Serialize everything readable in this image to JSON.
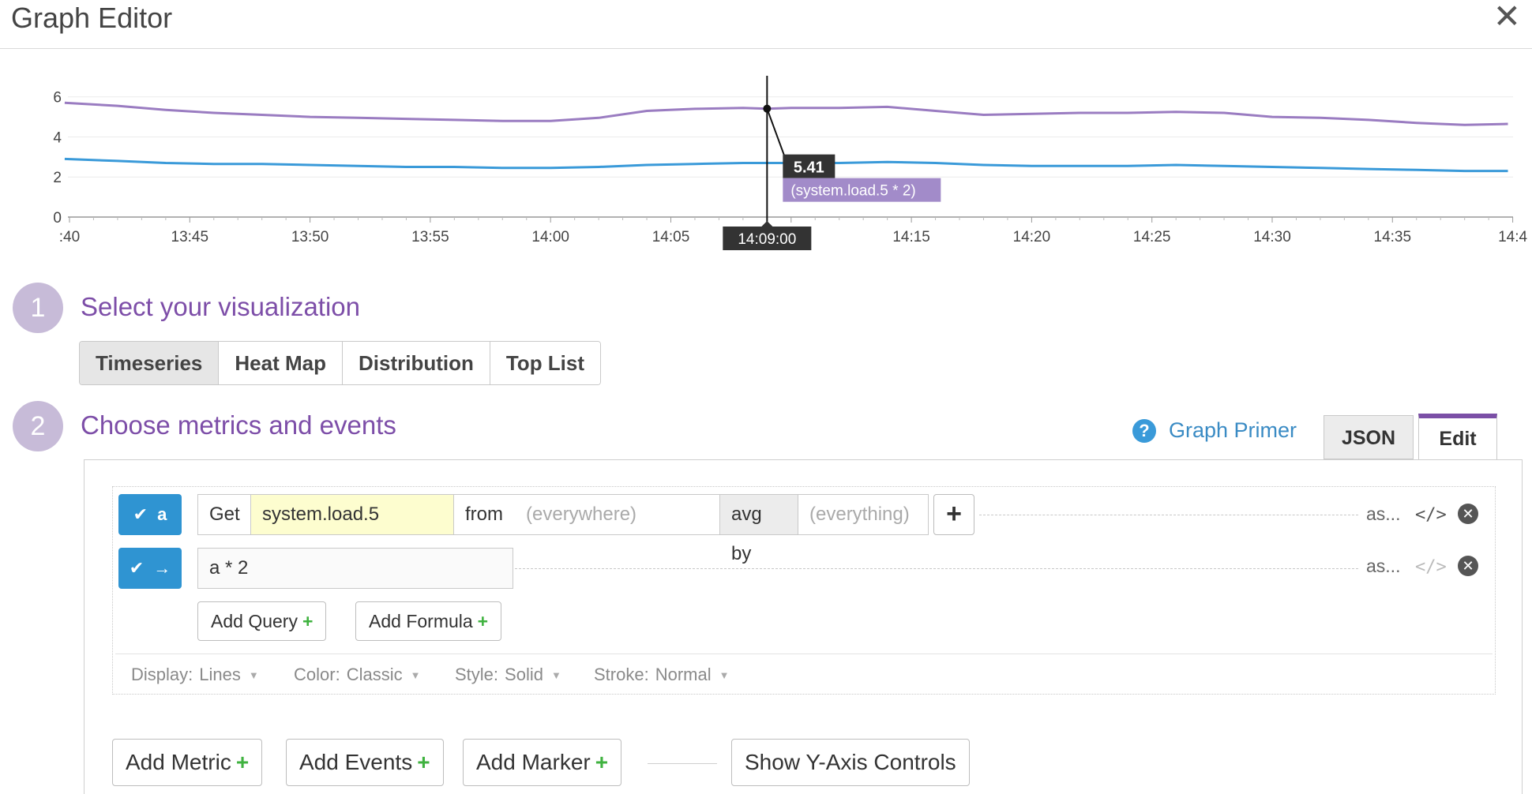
{
  "window": {
    "title": "Graph Editor",
    "close_glyph": "✕"
  },
  "chart_data": {
    "type": "line",
    "x_tick_labels": [
      ":40",
      "13:45",
      "13:50",
      "13:55",
      "14:00",
      "14:05",
      "14:10",
      "14:15",
      "14:20",
      "14:25",
      "14:30",
      "14:35",
      "14:4"
    ],
    "x_minutes": [
      0,
      5,
      10,
      15,
      20,
      25,
      30,
      35,
      40,
      45,
      50,
      55,
      60
    ],
    "ylim": [
      0,
      6.5
    ],
    "y_ticks": [
      0,
      2,
      4,
      6
    ],
    "series": [
      {
        "color": "#9a7cc1",
        "x": [
          -0.2,
          2,
          4,
          6,
          8,
          10,
          12,
          14,
          16,
          18,
          20,
          22,
          24,
          26,
          28,
          29,
          30,
          32,
          34,
          36,
          38,
          40,
          42,
          44,
          46,
          48,
          50,
          52,
          54,
          56,
          58,
          59.8
        ],
        "y": [
          5.7,
          5.55,
          5.35,
          5.2,
          5.1,
          5.0,
          4.95,
          4.9,
          4.85,
          4.8,
          4.8,
          4.95,
          5.3,
          5.4,
          5.45,
          5.41,
          5.45,
          5.45,
          5.5,
          5.3,
          5.1,
          5.15,
          5.2,
          5.2,
          5.25,
          5.2,
          5.0,
          4.95,
          4.85,
          4.7,
          4.6,
          4.65
        ]
      },
      {
        "name": "(system.load.5 * 2)",
        "color": "#3a9ad9",
        "x": [
          -0.2,
          2,
          4,
          6,
          8,
          10,
          12,
          14,
          16,
          18,
          20,
          22,
          24,
          26,
          28,
          30,
          32,
          34,
          36,
          38,
          40,
          42,
          44,
          46,
          48,
          50,
          52,
          54,
          56,
          58,
          59.8
        ],
        "y": [
          2.9,
          2.8,
          2.7,
          2.65,
          2.65,
          2.6,
          2.55,
          2.5,
          2.5,
          2.45,
          2.45,
          2.5,
          2.6,
          2.65,
          2.7,
          2.7,
          2.7,
          2.75,
          2.7,
          2.6,
          2.55,
          2.55,
          2.55,
          2.6,
          2.55,
          2.5,
          2.45,
          2.4,
          2.35,
          2.3,
          2.3
        ]
      }
    ],
    "tooltip": {
      "time": "14:09:00",
      "value": "5.41",
      "label": "(system.load.5 * 2)",
      "x": 29
    }
  },
  "step1": {
    "number": "1",
    "title": "Select your visualization"
  },
  "viz_tabs": [
    "Timeseries",
    "Heat Map",
    "Distribution",
    "Top List"
  ],
  "viz_active": "Timeseries",
  "step2": {
    "number": "2",
    "title": "Choose metrics and events"
  },
  "graph_primer": {
    "icon": "?",
    "label": "Graph Primer"
  },
  "mode_tabs": {
    "json": "JSON",
    "edit": "Edit"
  },
  "query_a": {
    "badge_check": "✔",
    "badge_label": "a",
    "get_label": "Get",
    "metric": "system.load.5",
    "from_label": "from",
    "from_value": "(everywhere)",
    "avg_by_label": "avg by",
    "avg_by_value": "(everything)",
    "add_glyph": "+",
    "alias": "as...",
    "code": "</>",
    "remove": "✕"
  },
  "formula_row": {
    "badge_check": "✔",
    "badge_arrow": "→",
    "formula": "a * 2",
    "alias": "as...",
    "code": "</>",
    "remove": "✕"
  },
  "add_query": {
    "label": "Add Query",
    "plus": "+"
  },
  "add_formula": {
    "label": "Add Formula",
    "plus": "+"
  },
  "display_options": {
    "display": {
      "label": "Display:",
      "value": "Lines"
    },
    "color": {
      "label": "Color:",
      "value": "Classic"
    },
    "style": {
      "label": "Style:",
      "value": "Solid"
    },
    "stroke": {
      "label": "Stroke:",
      "value": "Normal"
    },
    "caret": "▼"
  },
  "bottom_buttons": {
    "add_metric": "Add Metric",
    "add_events": "Add Events",
    "add_marker": "Add Marker",
    "plus": "+",
    "show_y_axis": "Show Y-Axis Controls"
  }
}
